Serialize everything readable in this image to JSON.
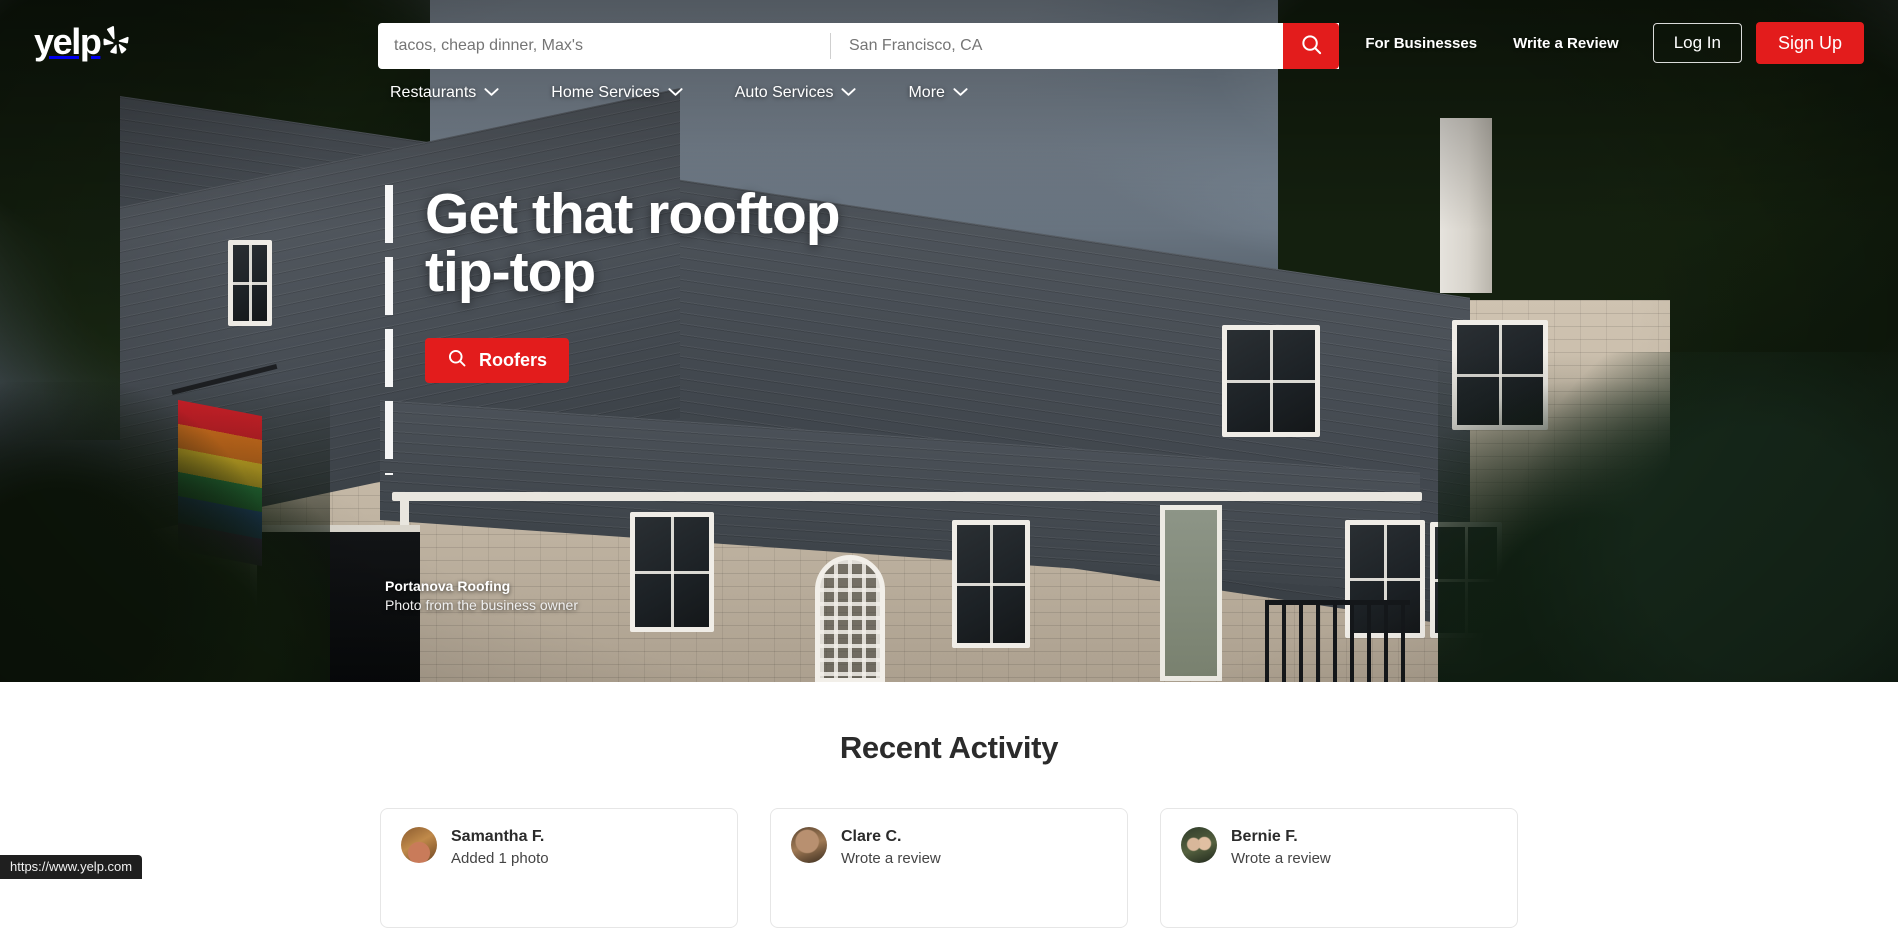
{
  "brand": {
    "name": "yelp",
    "accent_red": "#e31c1c",
    "logo_icon": "yelp-burst-icon"
  },
  "search": {
    "term_placeholder": "tacos, cheap dinner, Max's",
    "term_value": "",
    "location_placeholder": "San Francisco, CA",
    "location_value": "",
    "submit_icon": "search-icon"
  },
  "header": {
    "links": [
      {
        "label": "For Businesses"
      },
      {
        "label": "Write a Review"
      }
    ],
    "login_label": "Log In",
    "signup_label": "Sign Up"
  },
  "category_nav": {
    "items": [
      {
        "label": "Restaurants",
        "icon": "chevron-down-icon"
      },
      {
        "label": "Home Services",
        "icon": "chevron-down-icon"
      },
      {
        "label": "Auto Services",
        "icon": "chevron-down-icon"
      },
      {
        "label": "More",
        "icon": "chevron-down-icon"
      }
    ]
  },
  "hero": {
    "headline_line1": "Get that rooftop",
    "headline_line2": "tip-top",
    "cta_label": "Roofers",
    "cta_icon": "search-icon",
    "attribution_business": "Portanova Roofing",
    "attribution_source": "Photo from the business owner"
  },
  "activity": {
    "title": "Recent Activity",
    "cards": [
      {
        "name": "Samantha F.",
        "action": "Added 1 photo",
        "avatar": "user-avatar"
      },
      {
        "name": "Clare C.",
        "action": "Wrote a review",
        "avatar": "user-avatar"
      },
      {
        "name": "Bernie F.",
        "action": "Wrote a review",
        "avatar": "user-avatar"
      }
    ]
  },
  "browser": {
    "status_url": "https://www.yelp.com"
  }
}
